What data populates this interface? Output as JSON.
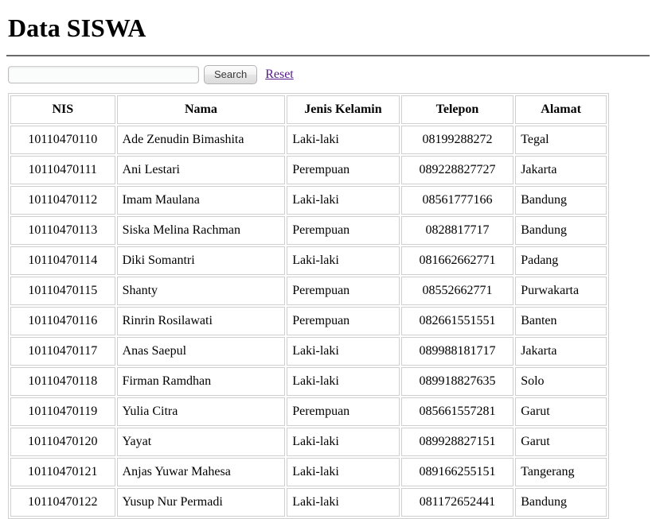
{
  "page": {
    "title": "Data SISWA"
  },
  "search": {
    "value": "",
    "placeholder": "",
    "search_button_label": "Search",
    "reset_link_label": "Reset"
  },
  "table": {
    "columns": [
      "NIS",
      "Nama",
      "Jenis Kelamin",
      "Telepon",
      "Alamat"
    ],
    "rows": [
      {
        "nis": "10110470110",
        "nama": "Ade Zenudin Bimashita",
        "jenis_kelamin": "Laki-laki",
        "telepon": "08199288272",
        "alamat": "Tegal"
      },
      {
        "nis": "10110470111",
        "nama": "Ani Lestari",
        "jenis_kelamin": "Perempuan",
        "telepon": "089228827727",
        "alamat": "Jakarta"
      },
      {
        "nis": "10110470112",
        "nama": "Imam Maulana",
        "jenis_kelamin": "Laki-laki",
        "telepon": "08561777166",
        "alamat": "Bandung"
      },
      {
        "nis": "10110470113",
        "nama": "Siska Melina Rachman",
        "jenis_kelamin": "Perempuan",
        "telepon": "0828817717",
        "alamat": "Bandung"
      },
      {
        "nis": "10110470114",
        "nama": "Diki Somantri",
        "jenis_kelamin": "Laki-laki",
        "telepon": "081662662771",
        "alamat": "Padang"
      },
      {
        "nis": "10110470115",
        "nama": "Shanty",
        "jenis_kelamin": "Perempuan",
        "telepon": "08552662771",
        "alamat": "Purwakarta"
      },
      {
        "nis": "10110470116",
        "nama": "Rinrin Rosilawati",
        "jenis_kelamin": "Perempuan",
        "telepon": "082661551551",
        "alamat": "Banten"
      },
      {
        "nis": "10110470117",
        "nama": "Anas Saepul",
        "jenis_kelamin": "Laki-laki",
        "telepon": "089988181717",
        "alamat": "Jakarta"
      },
      {
        "nis": "10110470118",
        "nama": "Firman Ramdhan",
        "jenis_kelamin": "Laki-laki",
        "telepon": "089918827635",
        "alamat": "Solo"
      },
      {
        "nis": "10110470119",
        "nama": "Yulia Citra",
        "jenis_kelamin": "Perempuan",
        "telepon": "085661557281",
        "alamat": "Garut"
      },
      {
        "nis": "10110470120",
        "nama": "Yayat",
        "jenis_kelamin": "Laki-laki",
        "telepon": "089928827151",
        "alamat": "Garut"
      },
      {
        "nis": "10110470121",
        "nama": "Anjas Yuwar Mahesa",
        "jenis_kelamin": "Laki-laki",
        "telepon": "089166255151",
        "alamat": "Tangerang"
      },
      {
        "nis": "10110470122",
        "nama": "Yusup Nur Permadi",
        "jenis_kelamin": "Laki-laki",
        "telepon": "081172652441",
        "alamat": "Bandung"
      }
    ]
  },
  "colors": {
    "link": "#551a8b",
    "border": "#cfcfcf",
    "rule": "#6b6b6b"
  }
}
